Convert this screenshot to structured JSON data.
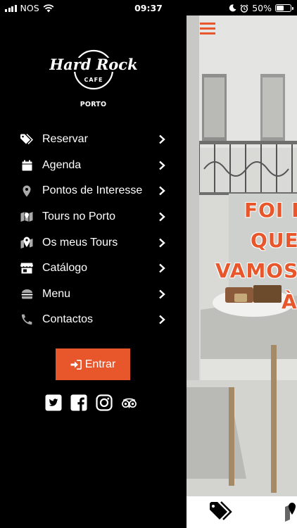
{
  "status_bar": {
    "carrier": "NOS",
    "time": "09:37",
    "battery": "50%",
    "battery_level": 0.5
  },
  "brand": {
    "logo_text": "Hard Rock",
    "logo_sub": "CAFE",
    "city": "PORTO",
    "accent": "#e8562b"
  },
  "menu": {
    "items": [
      {
        "label": "Reservar",
        "icon": "tag-icon"
      },
      {
        "label": "Agenda",
        "icon": "calendar-icon"
      },
      {
        "label": "Pontos de Interesse",
        "icon": "map-pin-icon"
      },
      {
        "label": "Tours no Porto",
        "icon": "map-icon"
      },
      {
        "label": "Os meus Tours",
        "icon": "map-pin-fold-icon"
      },
      {
        "label": "Catálogo",
        "icon": "store-icon"
      },
      {
        "label": "Menu",
        "icon": "burger-icon"
      },
      {
        "label": "Contactos",
        "icon": "phone-icon"
      }
    ],
    "login_label": "Entrar",
    "social": [
      "twitter-icon",
      "facebook-icon",
      "instagram-icon",
      "tripadvisor-icon"
    ]
  },
  "hero": {
    "lines": [
      "FOI BOM",
      "QUE",
      "VAMOS",
      "À"
    ]
  }
}
